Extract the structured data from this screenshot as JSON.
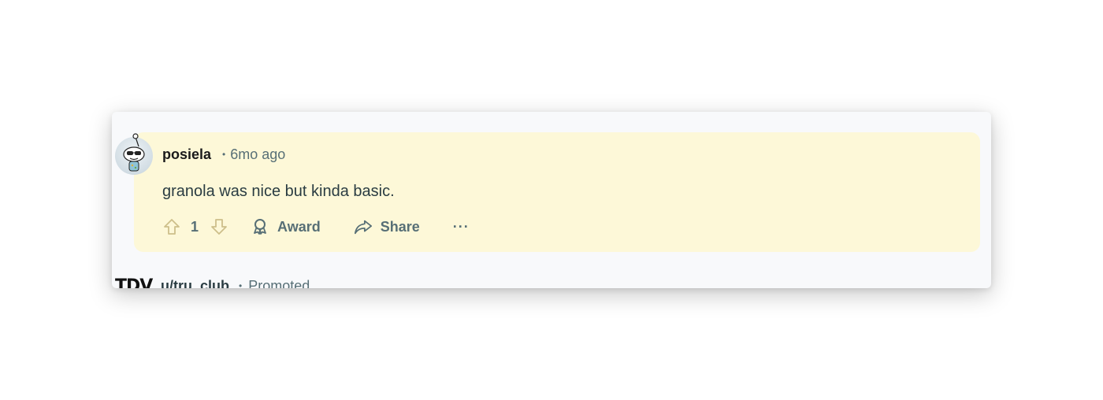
{
  "comment": {
    "username": "posiela",
    "separator": "•",
    "time": "6mo ago",
    "body": "granola was nice but kinda basic.",
    "score": "1"
  },
  "actions": {
    "award_label": "Award",
    "share_label": "Share",
    "more_label": "···"
  },
  "promo": {
    "logo_text": "TDV",
    "subreddit": "u/tru_club",
    "separator": "•",
    "label": "Promoted"
  },
  "colors": {
    "comment_highlight": "#fdf8d8",
    "card_background": "#f8f9fb",
    "muted_text": "#576f76",
    "username_text": "#1a1a1b"
  }
}
